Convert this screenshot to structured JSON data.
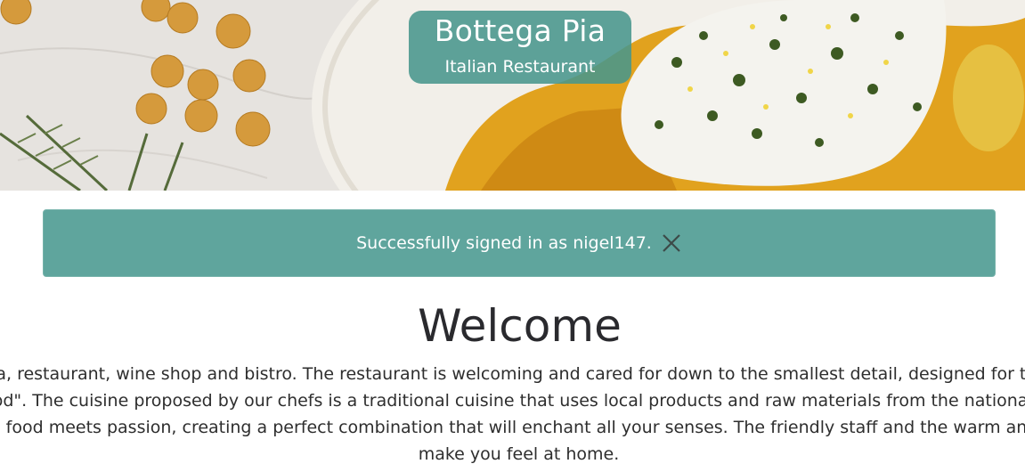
{
  "header": {
    "brand_title": "Bottega Pia",
    "brand_subtitle": "Italian Restaurant",
    "hero_image": "plated-fish-with-herbs-and-chickpeas-photo"
  },
  "alert": {
    "message": "Successfully signed in as nigel147.",
    "close_icon": "close-x-icon",
    "background": "#5fa59d"
  },
  "main": {
    "title": "Welcome",
    "intro_lines": [
      "Pia, restaurant, wine shop and bistro. The restaurant is welcoming and cared for down to the smallest detail, designed for thos",
      "ood\". The cuisine proposed by our chefs is a traditional cuisine that uses local products and raw materials from the national te",
      "re food meets passion, creating a perfect combination that will enchant all your senses. The friendly staff and the warm and p",
      "make you feel at home."
    ]
  },
  "colors": {
    "brand_box": "#48968c",
    "text": "#2b2b2b"
  }
}
